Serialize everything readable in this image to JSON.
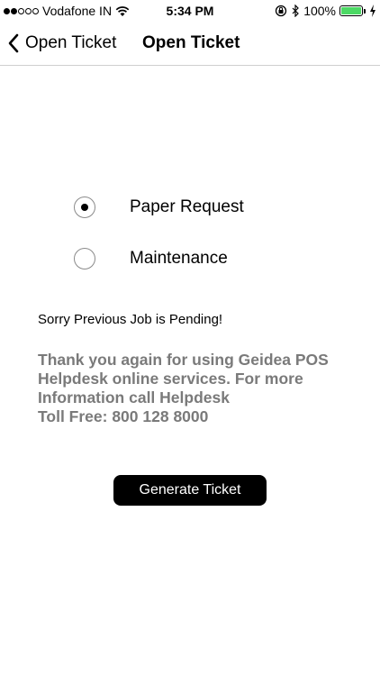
{
  "status_bar": {
    "carrier": "Vodafone IN",
    "time": "5:34 PM",
    "battery_percent": "100%",
    "battery_level": 1.0,
    "signal_filled": 2,
    "signal_total": 5
  },
  "nav": {
    "back_label": "Open Ticket",
    "title": "Open Ticket"
  },
  "options": [
    {
      "label": "Paper Request",
      "checked": true
    },
    {
      "label": "Maintenance",
      "checked": false
    }
  ],
  "message": {
    "pending": "Sorry Previous Job is Pending!",
    "info_line1": "Thank you again for using Geidea POS",
    "info_line2": "Helpdesk online services. For more",
    "info_line3": "Information call Helpdesk",
    "info_line4": "Toll Free: 800 128 8000"
  },
  "actions": {
    "generate_label": "Generate Ticket"
  },
  "colors": {
    "battery_fill": "#4cd964",
    "info_text": "#7a7a7a",
    "button_bg": "#000000"
  }
}
